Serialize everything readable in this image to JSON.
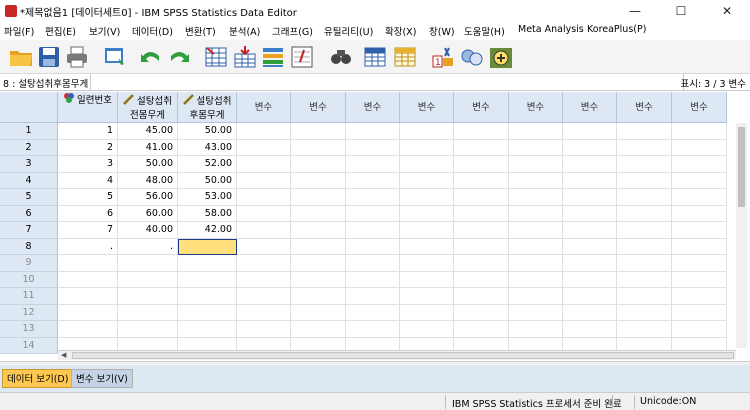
{
  "window": {
    "title": "*제목없음1 [데이터세트0] - IBM SPSS Statistics Data Editor",
    "controls": [
      "—",
      "☐",
      "✕"
    ]
  },
  "menu": [
    "파일(F)",
    "편집(E)",
    "보기(V)",
    "데이터(D)",
    "변환(T)",
    "분석(A)",
    "그래프(G)",
    "유틸리티(U)",
    "확장(X)",
    "창(W)",
    "도움말(H)",
    "Meta Analysis",
    "KoreaPlus(P)"
  ],
  "toolbar_icons": [
    "open-folder-icon",
    "save-icon",
    "print-icon",
    "dialog-recall-icon",
    "undo-icon",
    "redo-icon",
    "goto-case-icon",
    "goto-variable-icon",
    "variables-icon",
    "run-descriptives-icon",
    "find-icon",
    "insert-cases-icon",
    "insert-variable-icon",
    "split-file-icon",
    "weight-cases-icon",
    "select-cases-icon",
    "value-labels-icon",
    "use-sets-icon"
  ],
  "cell_editor": {
    "reference": "8 : 설탕섭취후몸무게",
    "value": "",
    "visible_vars": "표시: 3 / 3 변수"
  },
  "grid": {
    "columns": [
      {
        "label": "일련번호",
        "type": "nominal"
      },
      {
        "label": "설탕섭취\n전몸무게",
        "type": "scale"
      },
      {
        "label": "설탕섭취\n후몸무게",
        "type": "scale"
      },
      {
        "label": "변수",
        "type": "empty"
      },
      {
        "label": "변수",
        "type": "empty"
      },
      {
        "label": "변수",
        "type": "empty"
      },
      {
        "label": "변수",
        "type": "empty"
      },
      {
        "label": "변수",
        "type": "empty"
      },
      {
        "label": "변수",
        "type": "empty"
      },
      {
        "label": "변수",
        "type": "empty"
      },
      {
        "label": "변수",
        "type": "empty"
      },
      {
        "label": "변수",
        "type": "empty"
      }
    ],
    "rows": [
      {
        "num": "1",
        "cells": [
          "1",
          "45.00",
          "50.00"
        ]
      },
      {
        "num": "2",
        "cells": [
          "2",
          "41.00",
          "43.00"
        ]
      },
      {
        "num": "3",
        "cells": [
          "3",
          "50.00",
          "52.00"
        ]
      },
      {
        "num": "4",
        "cells": [
          "4",
          "48.00",
          "50.00"
        ]
      },
      {
        "num": "5",
        "cells": [
          "5",
          "56.00",
          "53.00"
        ]
      },
      {
        "num": "6",
        "cells": [
          "6",
          "60.00",
          "58.00"
        ]
      },
      {
        "num": "7",
        "cells": [
          "7",
          "40.00",
          "42.00"
        ]
      },
      {
        "num": "8",
        "cells": [
          ".",
          ".",
          ""
        ]
      },
      {
        "num": "9",
        "cells": [
          "",
          "",
          ""
        ]
      },
      {
        "num": "10",
        "cells": [
          "",
          "",
          ""
        ]
      },
      {
        "num": "11",
        "cells": [
          "",
          "",
          ""
        ]
      },
      {
        "num": "12",
        "cells": [
          "",
          "",
          ""
        ]
      },
      {
        "num": "13",
        "cells": [
          "",
          "",
          ""
        ]
      },
      {
        "num": "14",
        "cells": [
          "",
          "",
          ""
        ]
      }
    ],
    "selected_cell": {
      "row": 8,
      "column": 3
    }
  },
  "tabs": [
    "데이터 보기(D)",
    "변수 보기(V)"
  ],
  "active_tab": "데이터 보기(D)",
  "status": {
    "processor": "IBM SPSS Statistics 프로세서 준비 완료",
    "unicode": "Unicode:ON"
  },
  "colors": {
    "header_bg": "#dde8f4",
    "selected_cell": "#ffe07a",
    "active_tab": "#ffc850",
    "tab_strip": "#dfe9f3"
  }
}
